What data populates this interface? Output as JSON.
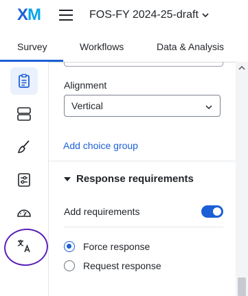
{
  "app": {
    "logo_x": "X",
    "logo_m": "M",
    "project_title": "FOS-FY 2024-25-draft"
  },
  "tabs": [
    {
      "label": "Survey",
      "active": true
    },
    {
      "label": "Workflows",
      "active": false
    },
    {
      "label": "Data & Analysis",
      "active": false
    }
  ],
  "rail": {
    "items": [
      {
        "icon": "clipboard-icon",
        "active": true
      },
      {
        "icon": "layout-blocks-icon",
        "active": false
      },
      {
        "icon": "paintbrush-icon",
        "active": false
      },
      {
        "icon": "sliders-icon",
        "active": false
      },
      {
        "icon": "gauge-icon",
        "active": false
      },
      {
        "icon": "translate-icon",
        "active": false
      }
    ],
    "annotation_color": "#5a1fb7"
  },
  "panel": {
    "alignment_label": "Alignment",
    "alignment_value": "Vertical",
    "add_choice_group": "Add choice group",
    "response_requirements": "Response requirements",
    "add_requirements_label": "Add requirements",
    "add_requirements_on": true,
    "options": [
      {
        "label": "Force response",
        "checked": true
      },
      {
        "label": "Request response",
        "checked": false
      }
    ]
  },
  "colors": {
    "accent": "#1b5fd6",
    "text": "#1f2328"
  }
}
